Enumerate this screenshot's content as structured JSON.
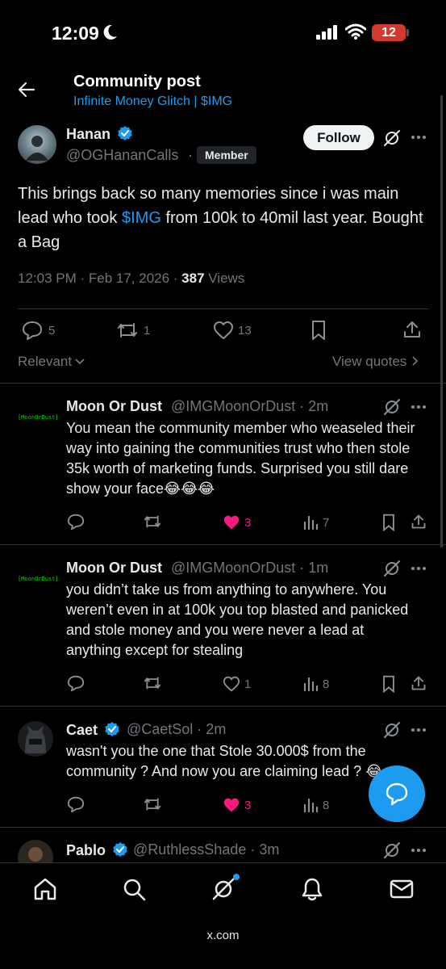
{
  "status_bar": {
    "time": "12:09",
    "battery": "12"
  },
  "header": {
    "title": "Community post",
    "subtitle": "Infinite Money Glitch | $IMG"
  },
  "post": {
    "name": "Hanan",
    "handle": "@OGHananCalls",
    "dot": "·",
    "badge": "Member",
    "follow_label": "Follow",
    "text_part1": "This brings back so many memories since i was main lead who took ",
    "text_link": "$IMG",
    "text_part2": " from 100k to 40mil last year. Bought a Bag",
    "meta_time": "12:03 PM · Feb 17, 2026 · ",
    "views_count": "387",
    "views_label": " Views",
    "replies": "5",
    "reposts": "1",
    "likes": "13",
    "sort_label": "Relevant",
    "view_quotes": "View quotes"
  },
  "replies": [
    {
      "name": "Moon Or Dust",
      "handle": "@IMGMoonOrDust · 2m",
      "avatar_text": "[MoonOrDust]",
      "text": "You mean the community member who weaseled their way into gaining the communities trust who then stole 35k worth of marketing funds. Surprised you still dare show your face😂😂😂",
      "likes": "3",
      "views": "7"
    },
    {
      "name": "Moon Or Dust",
      "handle": "@IMGMoonOrDust · 1m",
      "avatar_text": "[MoonOrDust]",
      "text": "you didn’t take us from anything to anywhere. You weren’t even in at 100k you top blasted and panicked and stole money and you were never a lead at anything except for stealing",
      "likes": "1",
      "views": "8"
    },
    {
      "name": "Caet",
      "handle": "@CaetSol · 2m",
      "text": "wasn't you the one that Stole 30.000$ from the community ? And now you are claiming lead ? 😂",
      "likes": "3",
      "views": "8"
    },
    {
      "name": "Pablo",
      "handle": "@RuthlessShade · 3m"
    }
  ],
  "footer": {
    "domain": "x.com"
  },
  "colors": {
    "accent": "#1d9bf0",
    "like": "#f91880",
    "background": "#000000"
  }
}
